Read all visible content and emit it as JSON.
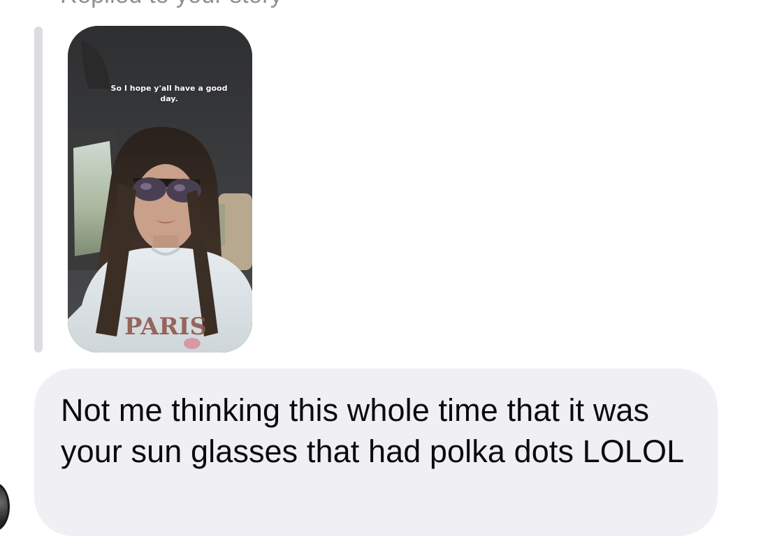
{
  "reply_header": "Replied to your story",
  "story": {
    "caption": "So I hope y'all have a good day."
  },
  "message": {
    "text": "Not me thinking this whole time that it was your sun glasses that had polka dots LOLOL"
  },
  "colors": {
    "bubble": "#efeff4",
    "quote_bar": "#dcdce1",
    "header_text": "#8e8e93",
    "message_text": "#0b0b0b"
  },
  "icons": {
    "avatar": "avatar"
  }
}
